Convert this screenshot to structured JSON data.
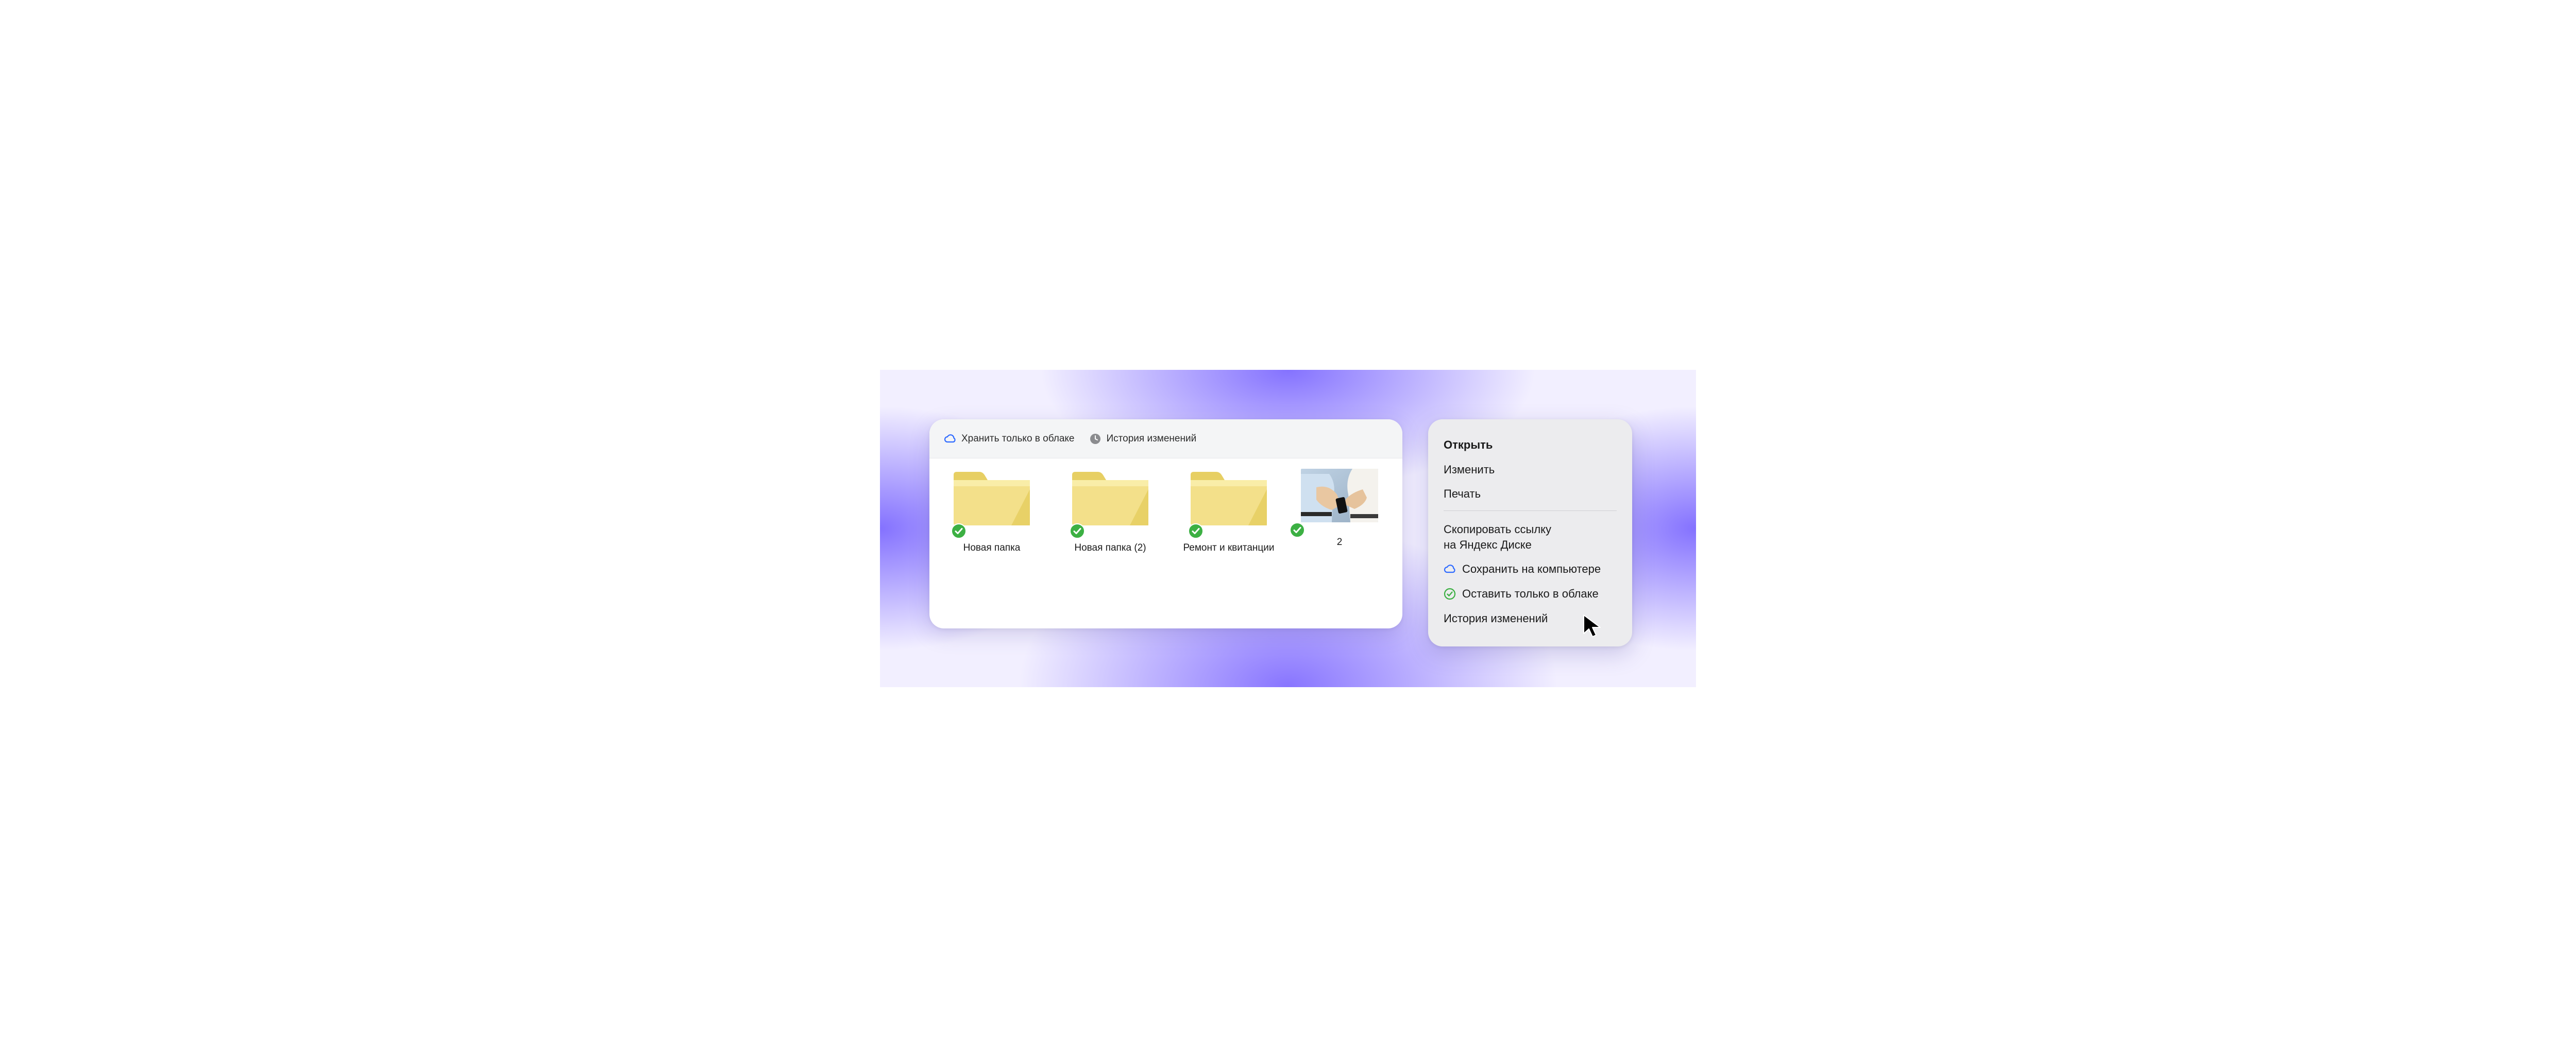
{
  "toolbar": {
    "cloud_only_label": "Хранить только в облаке",
    "history_label": "История изменений"
  },
  "files": [
    {
      "type": "folder",
      "label": "Новая папка",
      "status": "synced"
    },
    {
      "type": "folder",
      "label": "Новая папка (2)",
      "status": "synced"
    },
    {
      "type": "folder",
      "label": "Ремонт и квитанции",
      "status": "synced"
    },
    {
      "type": "image",
      "label": "2",
      "status": "synced"
    }
  ],
  "context_menu": {
    "open": "Открыть",
    "edit": "Изменить",
    "print": "Печать",
    "copy_link": "Скопировать ссылку\nна Яндекс Диске",
    "save_local": "Сохранить на компьютере",
    "cloud_only": "Оставить только в облаке",
    "history": "История изменений"
  },
  "colors": {
    "accent_blue": "#2f6bff",
    "success_green": "#3cb043",
    "folder_yellow": "#f3e08a",
    "folder_yellow_dark": "#e7cf63"
  }
}
